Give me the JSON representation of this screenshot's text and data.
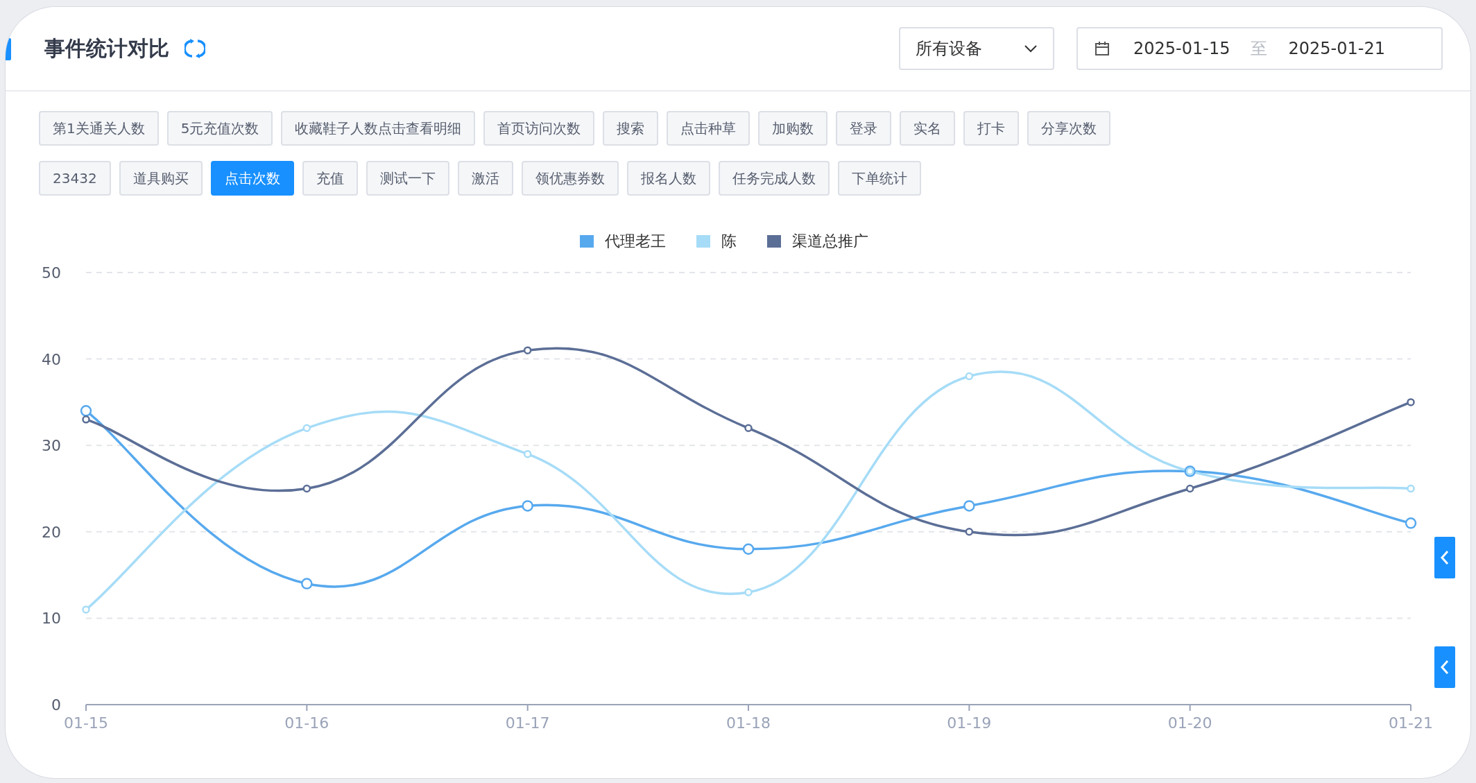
{
  "header": {
    "title": "事件统计对比",
    "device_select": {
      "value": "所有设备"
    },
    "date_range": {
      "start": "2025-01-15",
      "separator": "至",
      "end": "2025-01-21"
    }
  },
  "event_tags": [
    {
      "label": "第1关通关人数",
      "selected": false
    },
    {
      "label": "5元充值次数",
      "selected": false
    },
    {
      "label": "收藏鞋子人数点击查看明细",
      "selected": false
    },
    {
      "label": "首页访问次数",
      "selected": false
    },
    {
      "label": "搜索",
      "selected": false
    },
    {
      "label": "点击种草",
      "selected": false
    },
    {
      "label": "加购数",
      "selected": false
    },
    {
      "label": "登录",
      "selected": false
    },
    {
      "label": "实名",
      "selected": false
    },
    {
      "label": "打卡",
      "selected": false
    },
    {
      "label": "分享次数",
      "selected": false
    },
    {
      "label": "23432",
      "selected": false
    },
    {
      "label": "道具购买",
      "selected": false
    },
    {
      "label": "点击次数",
      "selected": true
    },
    {
      "label": "充值",
      "selected": false
    },
    {
      "label": "测试一下",
      "selected": false
    },
    {
      "label": "激活",
      "selected": false
    },
    {
      "label": "领优惠券数",
      "selected": false
    },
    {
      "label": "报名人数",
      "selected": false
    },
    {
      "label": "任务完成人数",
      "selected": false
    },
    {
      "label": "下单统计",
      "selected": false
    }
  ],
  "chart": {
    "chart_data": {
      "type": "line",
      "categories": [
        "01-15",
        "01-16",
        "01-17",
        "01-18",
        "01-19",
        "01-20",
        "01-21"
      ],
      "ylim": [
        0,
        50
      ],
      "grid": true,
      "yticks": [
        0,
        10,
        20,
        30,
        40,
        50
      ],
      "series": [
        {
          "name": "代理老王",
          "color": "#57a9ee",
          "marker": "circle",
          "values": [
            34,
            14,
            23,
            18,
            23,
            27,
            21
          ]
        },
        {
          "name": "陈",
          "color": "#a6dcf7",
          "marker": "circle",
          "values": [
            11,
            32,
            29,
            13,
            38,
            27,
            25
          ]
        },
        {
          "name": "渠道总推广",
          "color": "#5b6e96",
          "marker": "circle",
          "values": [
            33,
            25,
            41,
            32,
            20,
            25,
            35
          ]
        }
      ]
    }
  }
}
